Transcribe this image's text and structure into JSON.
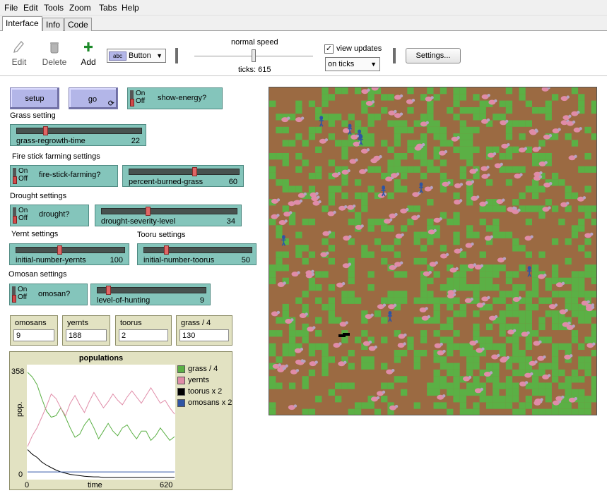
{
  "menu": [
    "File",
    "Edit",
    "Tools",
    "Zoom",
    "Tabs",
    "Help"
  ],
  "tabs": [
    "Interface",
    "Info",
    "Code"
  ],
  "toolbar": {
    "edit_label": "Edit",
    "delete_label": "Delete",
    "add_label": "Add",
    "widget_type_icon": "abc",
    "widget_type": "Button",
    "speed_label": "normal speed",
    "speed_fraction": 0.5,
    "ticks_text": "ticks: 615",
    "view_updates_label": "view updates",
    "view_updates_checked": true,
    "update_mode": "on ticks",
    "settings_label": "Settings..."
  },
  "buttons": {
    "setup": "setup",
    "go": "go"
  },
  "switches": {
    "show_energy": {
      "label": "show-energy?",
      "on": "On",
      "off": "Off",
      "state": "off"
    },
    "fire_stick": {
      "label": "fire-stick-farming?",
      "on": "On",
      "off": "Off",
      "state": "off"
    },
    "drought": {
      "label": "drought?",
      "on": "On",
      "off": "Off",
      "state": "off"
    },
    "omosan": {
      "label": "omosan?",
      "on": "On",
      "off": "Off",
      "state": "off"
    }
  },
  "sections": {
    "grass": "Grass setting",
    "fire": "Fire stick farming settings",
    "drought": "Drought settings",
    "yernt": "Yernt settings",
    "tooru": "Tooru settings",
    "omosan": "Omosan settings"
  },
  "sliders": {
    "grass_regrowth": {
      "name": "grass-regrowth-time",
      "value": "22",
      "fraction": 0.22
    },
    "percent_burned": {
      "name": "percent-burned-grass",
      "value": "60",
      "fraction": 0.6
    },
    "drought_severity": {
      "name": "drought-severity-level",
      "value": "34",
      "fraction": 0.34
    },
    "initial_yernts": {
      "name": "initial-number-yernts",
      "value": "100",
      "fraction": 0.4
    },
    "initial_toorus": {
      "name": "initial-number-toorus",
      "value": "50",
      "fraction": 0.2
    },
    "level_hunting": {
      "name": "level-of-hunting",
      "value": "9",
      "fraction": 0.09
    }
  },
  "monitors": [
    {
      "label": "omosans",
      "value": "9"
    },
    {
      "label": "yernts",
      "value": "188"
    },
    {
      "label": "toorus",
      "value": "2"
    },
    {
      "label": "grass / 4",
      "value": "130"
    }
  ],
  "plot": {
    "title": "populations",
    "ylabel": "pop.",
    "xlabel": "time",
    "ymax_label": "358",
    "ymin_label": "0",
    "xmin_label": "0",
    "xmax_label": "620"
  },
  "colors": {
    "grass": "#5bb045",
    "yernts": "#e08ca8",
    "toorus": "#000000",
    "omosans": "#2f55a4",
    "dirt": "#9b6a42"
  },
  "chart_data": {
    "type": "line",
    "title": "populations",
    "xlabel": "time",
    "ylabel": "pop.",
    "xlim": [
      0,
      620
    ],
    "ylim": [
      0,
      358
    ],
    "series": [
      {
        "name": "grass / 4",
        "x": [
          0,
          20,
          40,
          60,
          80,
          100,
          120,
          140,
          160,
          180,
          200,
          220,
          240,
          260,
          280,
          300,
          320,
          340,
          360,
          380,
          400,
          420,
          440,
          460,
          480,
          500,
          520,
          540,
          560,
          580,
          600,
          620
        ],
        "values": [
          340,
          325,
          300,
          255,
          215,
          195,
          200,
          225,
          195,
          160,
          130,
          140,
          170,
          190,
          160,
          125,
          150,
          175,
          150,
          135,
          160,
          170,
          145,
          125,
          150,
          150,
          120,
          135,
          160,
          140,
          120,
          132
        ]
      },
      {
        "name": "yernts",
        "x": [
          0,
          20,
          40,
          60,
          80,
          100,
          120,
          140,
          160,
          180,
          200,
          220,
          240,
          260,
          280,
          300,
          320,
          340,
          360,
          380,
          400,
          420,
          440,
          460,
          480,
          500,
          520,
          540,
          560,
          580,
          600,
          620
        ],
        "values": [
          100,
          135,
          160,
          195,
          230,
          270,
          255,
          225,
          200,
          240,
          265,
          235,
          210,
          245,
          275,
          250,
          225,
          245,
          270,
          250,
          235,
          260,
          280,
          260,
          240,
          265,
          290,
          265,
          240,
          250,
          225,
          205
        ]
      },
      {
        "name": "toorus x 2",
        "x": [
          0,
          20,
          40,
          60,
          80,
          100,
          120,
          140,
          160,
          180,
          200,
          220,
          240,
          260,
          280,
          300,
          320,
          340,
          360,
          380,
          400,
          420,
          440,
          460,
          480,
          500,
          520,
          540,
          560,
          580,
          600,
          620
        ],
        "values": [
          90,
          75,
          65,
          50,
          40,
          32,
          24,
          18,
          14,
          10,
          8,
          6,
          4,
          3,
          2,
          2,
          0,
          0,
          0,
          0,
          0,
          0,
          0,
          0,
          0,
          0,
          0,
          0,
          0,
          0,
          0,
          0
        ]
      },
      {
        "name": "omosans x 2",
        "x": [
          0,
          620
        ],
        "values": [
          18,
          18
        ]
      }
    ]
  }
}
